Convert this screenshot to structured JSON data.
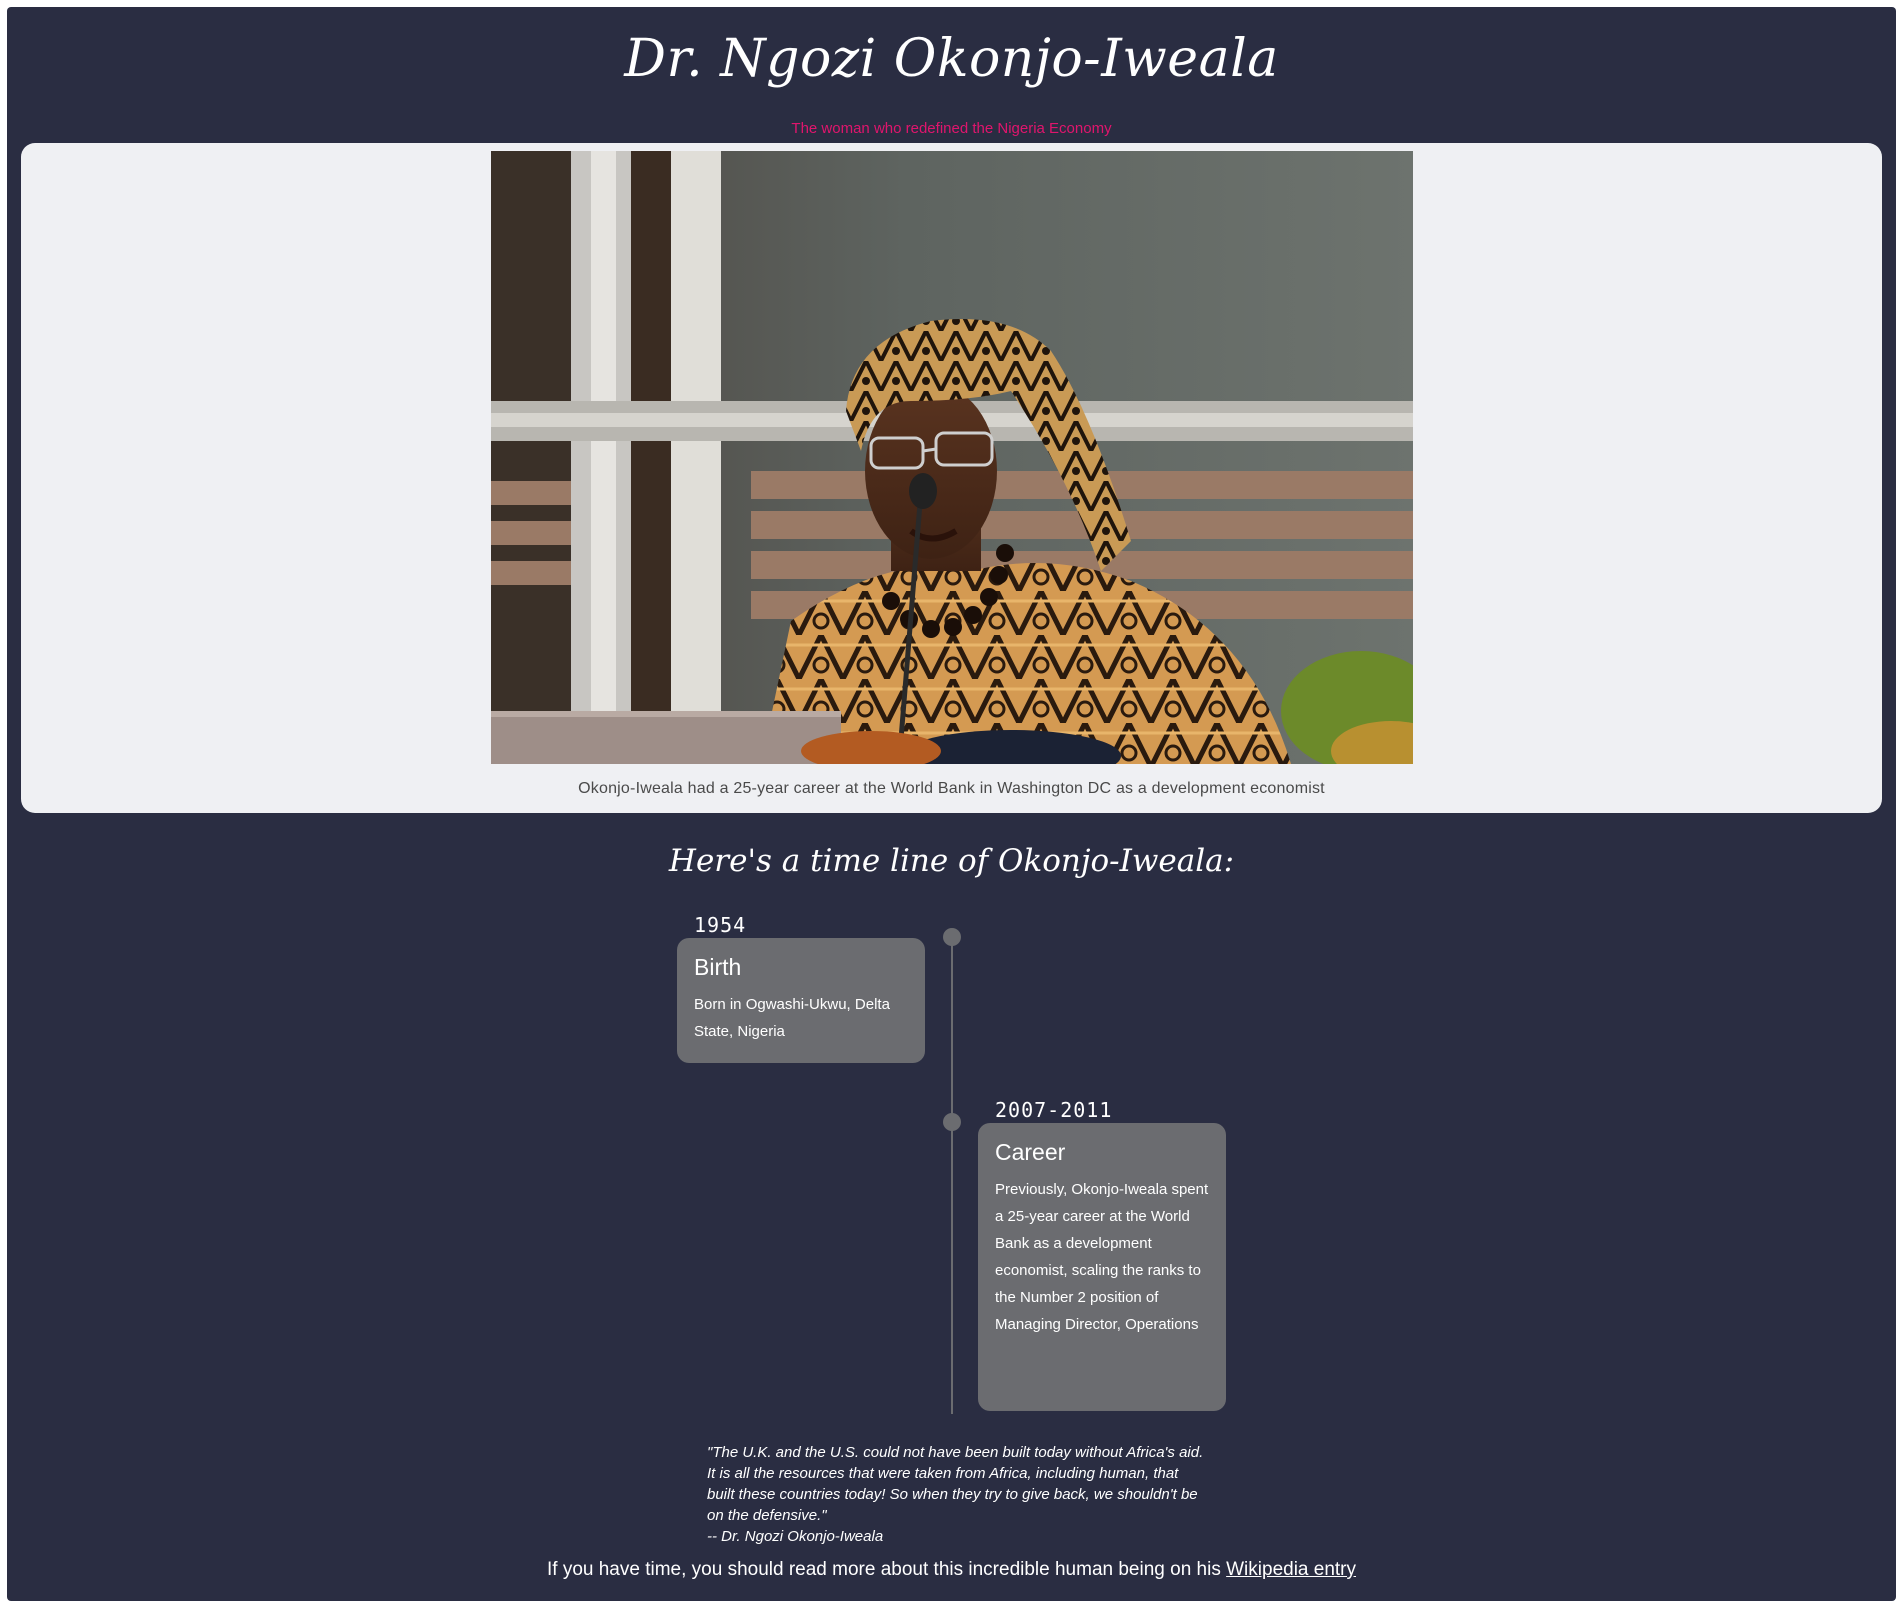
{
  "header": {
    "title": "Dr. Ngozi Okonjo-Iweala",
    "subtitle": "The woman who redefined the Nigeria Economy"
  },
  "image_card": {
    "caption": "Okonjo-Iweala had a 25-year career at the World Bank in Washington DC as a development economist"
  },
  "timeline": {
    "heading": "Here's a time line of Okonjo-Iweala:",
    "events": [
      {
        "year": "1954",
        "title": "Birth",
        "text": "Born in Ogwashi-Ukwu, Delta State, Nigeria"
      },
      {
        "year": "2007-2011",
        "title": "Career",
        "text": "Previously, Okonjo-Iweala spent a 25-year career at the World Bank as a development economist, scaling the ranks to the Number 2 position of Managing Director, Operations"
      }
    ]
  },
  "quote": {
    "text": "\"The U.K. and the U.S. could not have been built today without Africa's aid. It is all the resources that were taken from Africa, including human, that built these countries today! So when they try to give back, we shouldn't be on the defensive.\"",
    "author": "-- Dr. Ngozi Okonjo-Iweala"
  },
  "footer": {
    "text": "If you have time, you should read more about this incredible human being on his",
    "link_label": "Wikipedia entry"
  },
  "colors": {
    "page_background": "#2a2d42",
    "subtitle": "#e0156d",
    "card_background": "#eff0f3",
    "timeline_card": "#6b6c70"
  }
}
